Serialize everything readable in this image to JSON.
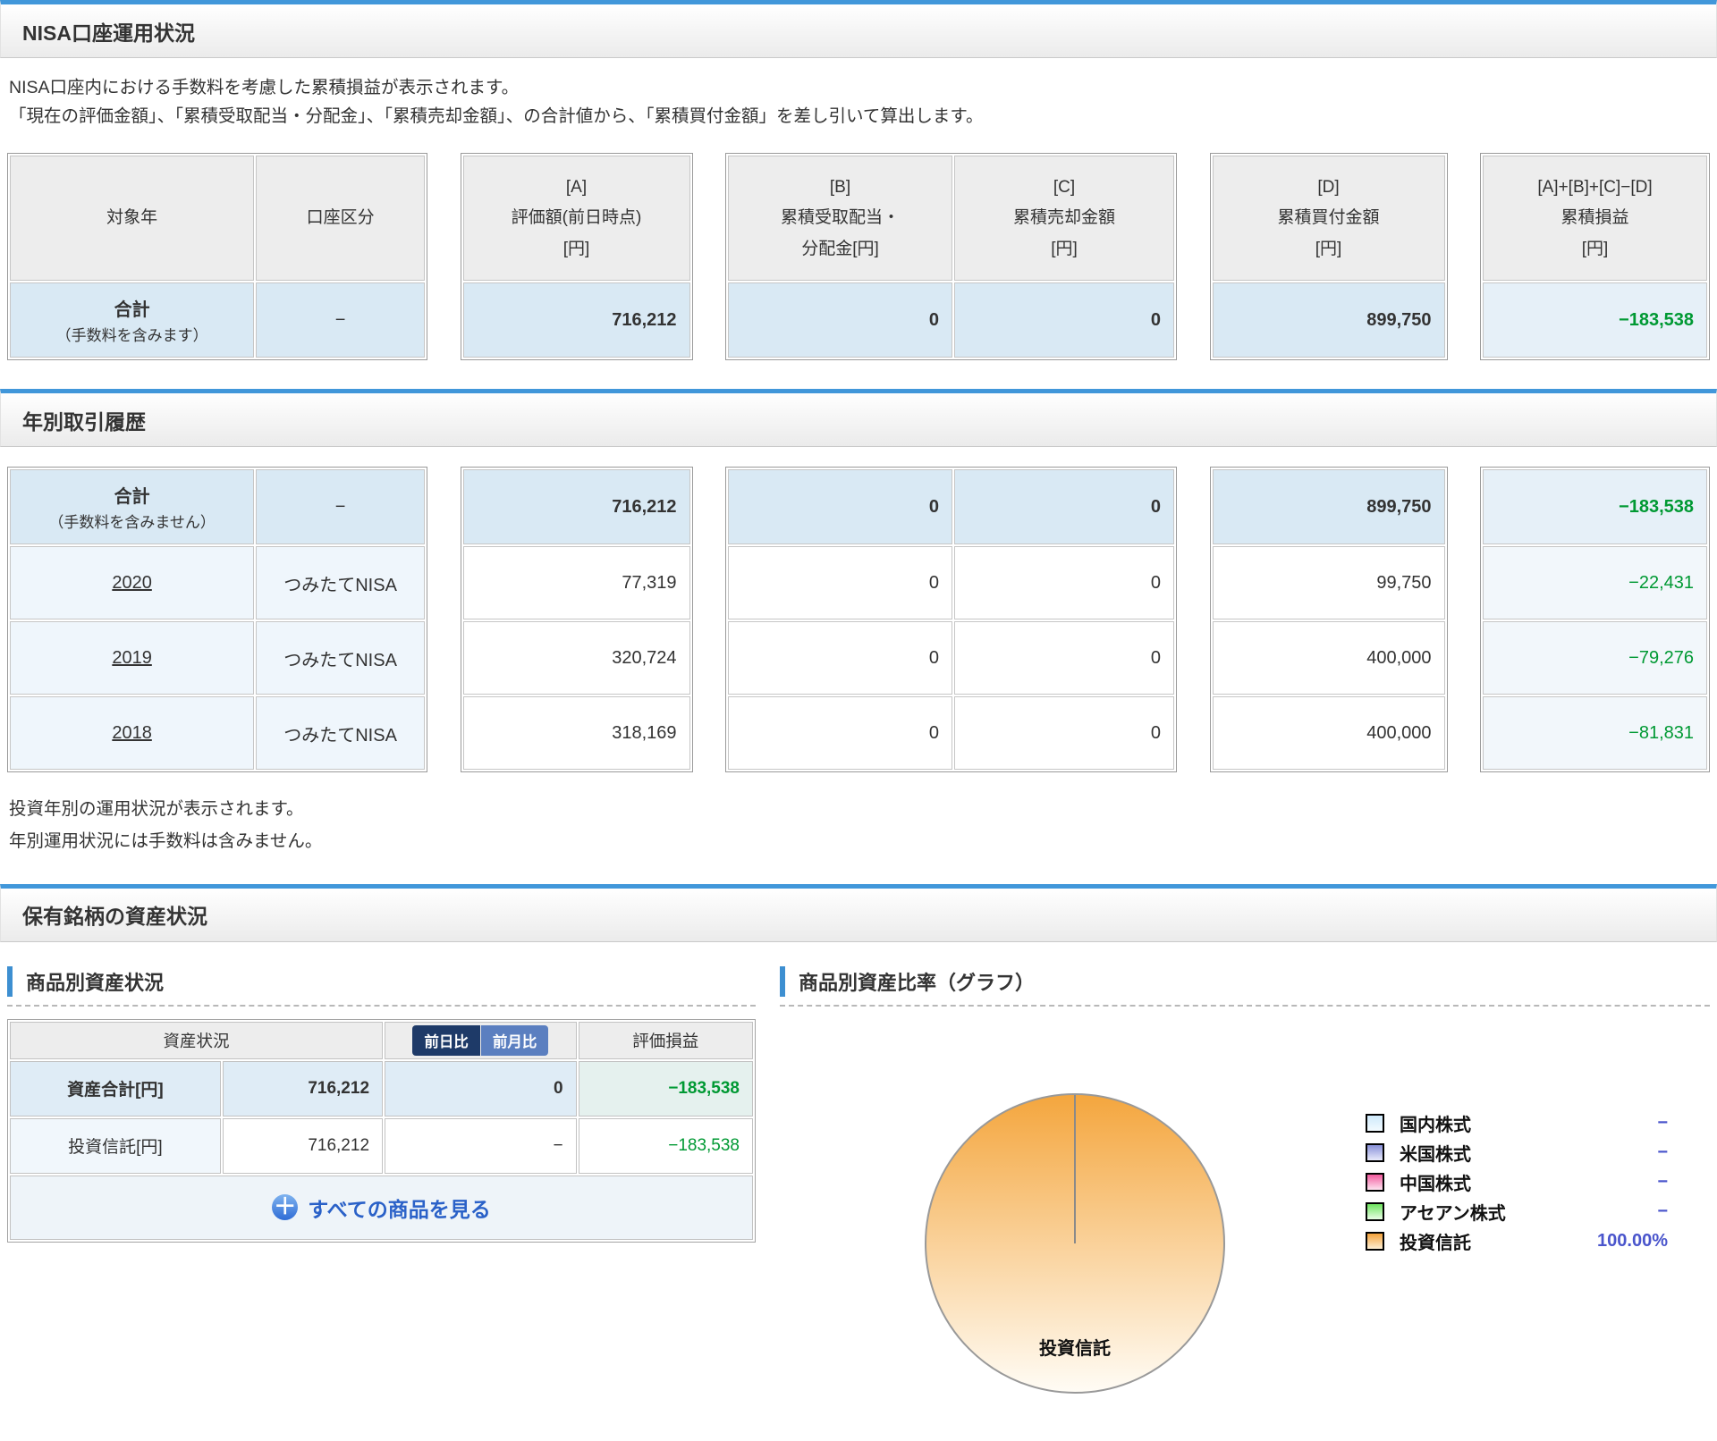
{
  "sections": {
    "account_status_title": "NISA口座運用状況",
    "yearly_history_title": "年別取引履歴",
    "holdings_title": "保有銘柄の資産状況"
  },
  "description": {
    "line1": "NISA口座内における手数料を考慮した累積損益が表示されます。",
    "line2": "「現在の評価金額」、「累積受取配当・分配金」、「累積売却金額」、の合計値から、「累積買付金額」を差し引いて算出します。"
  },
  "notes": {
    "line1": "投資年別の運用状況が表示されます。",
    "line2": "年別運用状況には手数料は含みません。"
  },
  "summary_table": {
    "headers": {
      "target_year": "対象年",
      "account_type": "口座区分",
      "a1": "[A]",
      "a2": "評価額(前日時点)",
      "a3": "[円]",
      "b1": "[B]",
      "b2": "累積受取配当・",
      "b3": "分配金[円]",
      "c1": "[C]",
      "c2": "累積売却金額",
      "c3": "[円]",
      "d1": "[D]",
      "d2": "累積買付金額",
      "d3": "[円]",
      "pl1": "[A]+[B]+[C]−[D]",
      "pl2": "累積損益",
      "pl3": "[円]"
    },
    "total_row": {
      "label": "合計",
      "label_note": "（手数料を含みます）",
      "account_type": "−",
      "valuation": "716,212",
      "dividends": "0",
      "sales": "0",
      "purchases": "899,750",
      "profit_loss": "−183,538"
    }
  },
  "yearly_table": {
    "total_row": {
      "label": "合計",
      "label_note": "（手数料を含みません）",
      "account_type": "−",
      "valuation": "716,212",
      "dividends": "0",
      "sales": "0",
      "purchases": "899,750",
      "profit_loss": "−183,538"
    },
    "rows": [
      {
        "year": "2020",
        "account_type": "つみたてNISA",
        "valuation": "77,319",
        "dividends": "0",
        "sales": "0",
        "purchases": "99,750",
        "profit_loss": "−22,431"
      },
      {
        "year": "2019",
        "account_type": "つみたてNISA",
        "valuation": "320,724",
        "dividends": "0",
        "sales": "0",
        "purchases": "400,000",
        "profit_loss": "−79,276"
      },
      {
        "year": "2018",
        "account_type": "つみたてNISA",
        "valuation": "318,169",
        "dividends": "0",
        "sales": "0",
        "purchases": "400,000",
        "profit_loss": "−81,831"
      }
    ]
  },
  "asset_status": {
    "title": "商品別資産状況",
    "header_asset": "資産状況",
    "btn_prev_day": "前日比",
    "btn_prev_month": "前月比",
    "header_pl": "評価損益",
    "rows": [
      {
        "label": "資産合計[円]",
        "value": "716,212",
        "change": "0",
        "pl": "−183,538"
      },
      {
        "label": "投資信託[円]",
        "value": "716,212",
        "change": "−",
        "pl": "−183,538"
      }
    ],
    "footer_link": "すべての商品を見る",
    "plus_icon": "＋"
  },
  "asset_ratio": {
    "title": "商品別資産比率（グラフ）"
  },
  "chart_data": {
    "type": "pie",
    "title": "商品別資産比率（グラフ）",
    "slices": [
      {
        "label": "投資信託",
        "value": 100.0
      }
    ],
    "center_label": "投資信託",
    "pie_gradient_top": "#f4a63e",
    "pie_gradient_bottom": "#fffcf5",
    "legend_position": "right",
    "legend": [
      {
        "label": "国内株式",
        "value": "−",
        "color_top": "#cfe9fb",
        "color_bottom": "#f2faff"
      },
      {
        "label": "米国株式",
        "value": "−",
        "color_top": "#8890d8",
        "color_bottom": "#e8eafb"
      },
      {
        "label": "中国株式",
        "value": "−",
        "color_top": "#f25a9e",
        "color_bottom": "#fde4f0"
      },
      {
        "label": "アセアン株式",
        "value": "−",
        "color_top": "#6ee45f",
        "color_bottom": "#eafde6"
      },
      {
        "label": "投資信託",
        "value": "100.00%",
        "color_top": "#f3a23b",
        "color_bottom": "#fdeed3"
      }
    ]
  },
  "colors": {
    "section_bar_blue": "#4197da",
    "subtitle_bar_blue": "#3d8fd1",
    "total_row_bg": "#d9e9f4",
    "profit_green": "#009933",
    "link_blue": "#2a61c8",
    "legend_value_blue": "#4a55cc",
    "btn_selected_navy": "#1e3a68",
    "btn_unselected_blue": "#5b7fc0"
  }
}
